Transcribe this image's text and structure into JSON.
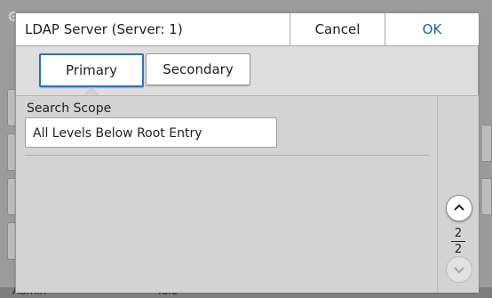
{
  "dialog": {
    "title": "LDAP Server (Server: 1)",
    "cancel_label": "Cancel",
    "ok_label": "OK"
  },
  "tabs": [
    {
      "label": "Primary",
      "selected": true
    },
    {
      "label": "Secondary",
      "selected": false
    }
  ],
  "search_scope": {
    "label": "Search Scope",
    "value": "All Levels Below Root Entry"
  },
  "pager": {
    "current": "2",
    "total": "2"
  },
  "background": {
    "user": "Admin",
    "status": "Idle"
  },
  "colors": {
    "ok_text": "#1a5fb4",
    "selected_tab_border": "#2a73c7"
  }
}
